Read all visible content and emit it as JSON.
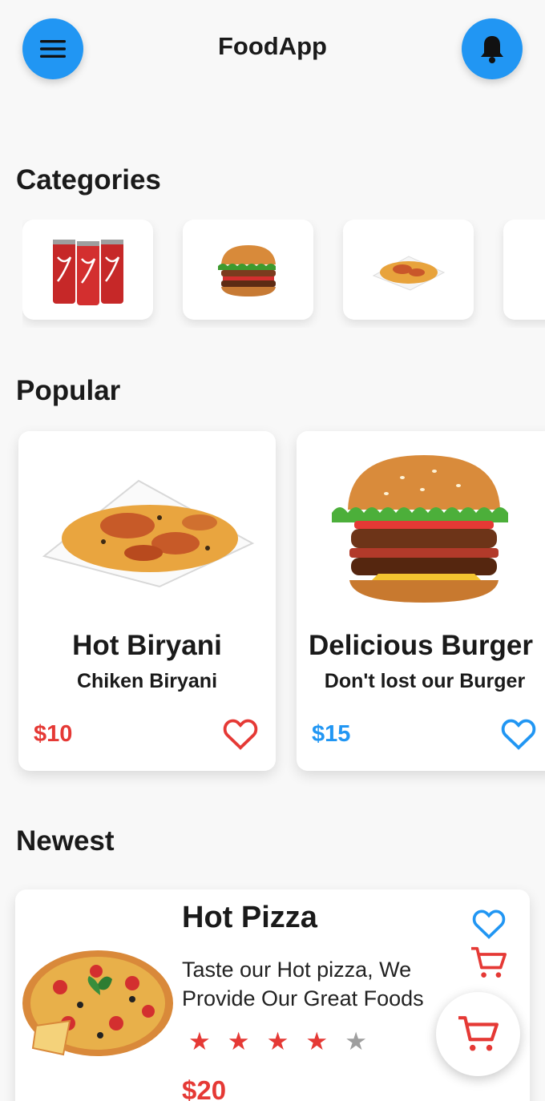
{
  "header": {
    "title": "FoodApp",
    "menu_icon": "hamburger-menu-icon",
    "bell_icon": "bell-icon"
  },
  "sections": {
    "categories": "Categories",
    "popular": "Popular",
    "newest": "Newest"
  },
  "categories": [
    {
      "icon": "soda-cans-image"
    },
    {
      "icon": "burger-image"
    },
    {
      "icon": "biryani-plate-image"
    },
    {
      "icon": "food-image"
    }
  ],
  "popular": [
    {
      "name": "Hot Biryani",
      "subtitle": "Chiken Biryani",
      "price": "$10",
      "price_color": "#e53935",
      "heart_color": "#e53935"
    },
    {
      "name": "Delicious Burger",
      "subtitle": "Don't lost our Burger",
      "price": "$15",
      "price_color": "#2196f3",
      "heart_color": "#2196f3"
    }
  ],
  "newest": [
    {
      "name": "Hot Pizza",
      "description": "Taste our Hot pizza, We Provide Our Great Foods",
      "rating": 4,
      "rating_max": 5,
      "price": "$20"
    }
  ],
  "colors": {
    "accent_blue": "#2196f3",
    "accent_red": "#e53935",
    "star_off": "#9e9e9e"
  }
}
